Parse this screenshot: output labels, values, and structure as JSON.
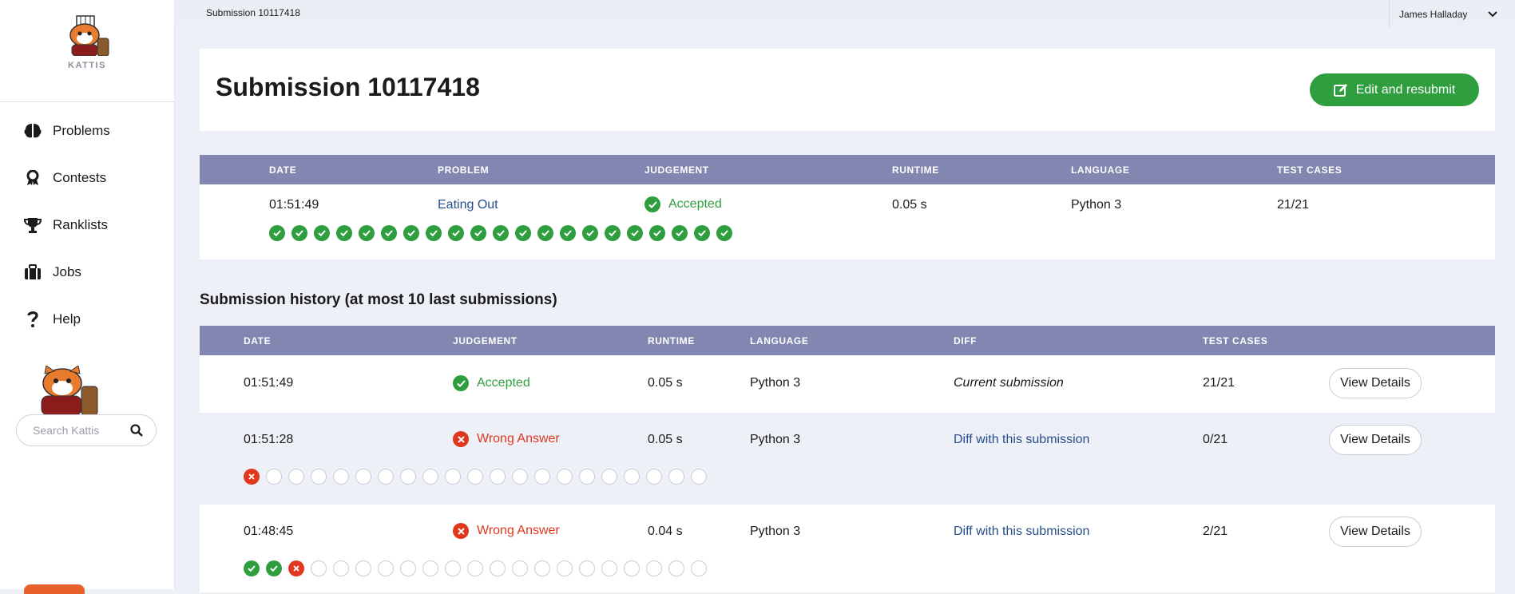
{
  "sidebar": {
    "logo_text": "KATTIS",
    "items": [
      {
        "label": "Problems",
        "icon": "brain-icon"
      },
      {
        "label": "Contests",
        "icon": "award-icon"
      },
      {
        "label": "Ranklists",
        "icon": "trophy-icon"
      },
      {
        "label": "Jobs",
        "icon": "briefcase-icon"
      },
      {
        "label": "Help",
        "icon": "question-icon"
      }
    ],
    "search_placeholder": "Search Kattis"
  },
  "topbar": {
    "breadcrumb": "Submission 10117418",
    "user_name": "James Halladay"
  },
  "header": {
    "title": "Submission 10117418",
    "resubmit_label": "Edit and resubmit"
  },
  "summary": {
    "columns": [
      "DATE",
      "PROBLEM",
      "JUDGEMENT",
      "RUNTIME",
      "LANGUAGE",
      "TEST CASES"
    ],
    "row": {
      "date": "01:51:49",
      "problem": "Eating Out",
      "judgement": "Accepted",
      "runtime": "0.05 s",
      "language": "Python 3",
      "test_cases": "21/21",
      "case_results": [
        "pass",
        "pass",
        "pass",
        "pass",
        "pass",
        "pass",
        "pass",
        "pass",
        "pass",
        "pass",
        "pass",
        "pass",
        "pass",
        "pass",
        "pass",
        "pass",
        "pass",
        "pass",
        "pass",
        "pass",
        "pass"
      ]
    }
  },
  "history": {
    "title": "Submission history (at most 10 last submissions)",
    "columns": [
      "DATE",
      "JUDGEMENT",
      "RUNTIME",
      "LANGUAGE",
      "DIFF",
      "TEST CASES"
    ],
    "view_label": "View Details",
    "rows": [
      {
        "date": "01:51:49",
        "judgement": "Accepted",
        "runtime": "0.05 s",
        "language": "Python 3",
        "diff": "Current submission",
        "test_cases": "21/21",
        "case_results": []
      },
      {
        "date": "01:51:28",
        "judgement": "Wrong Answer",
        "runtime": "0.05 s",
        "language": "Python 3",
        "diff": "Diff with this submission",
        "test_cases": "0/21",
        "case_results": [
          "fail",
          "none",
          "none",
          "none",
          "none",
          "none",
          "none",
          "none",
          "none",
          "none",
          "none",
          "none",
          "none",
          "none",
          "none",
          "none",
          "none",
          "none",
          "none",
          "none",
          "none"
        ]
      },
      {
        "date": "01:48:45",
        "judgement": "Wrong Answer",
        "runtime": "0.04 s",
        "language": "Python 3",
        "diff": "Diff with this submission",
        "test_cases": "2/21",
        "case_results": [
          "pass",
          "pass",
          "fail",
          "none",
          "none",
          "none",
          "none",
          "none",
          "none",
          "none",
          "none",
          "none",
          "none",
          "none",
          "none",
          "none",
          "none",
          "none",
          "none",
          "none",
          "none"
        ]
      }
    ]
  },
  "colors": {
    "accent_green": "#2e9e3e",
    "error_red": "#e0371f",
    "table_header": "#8187b0",
    "link": "#274d8c"
  }
}
